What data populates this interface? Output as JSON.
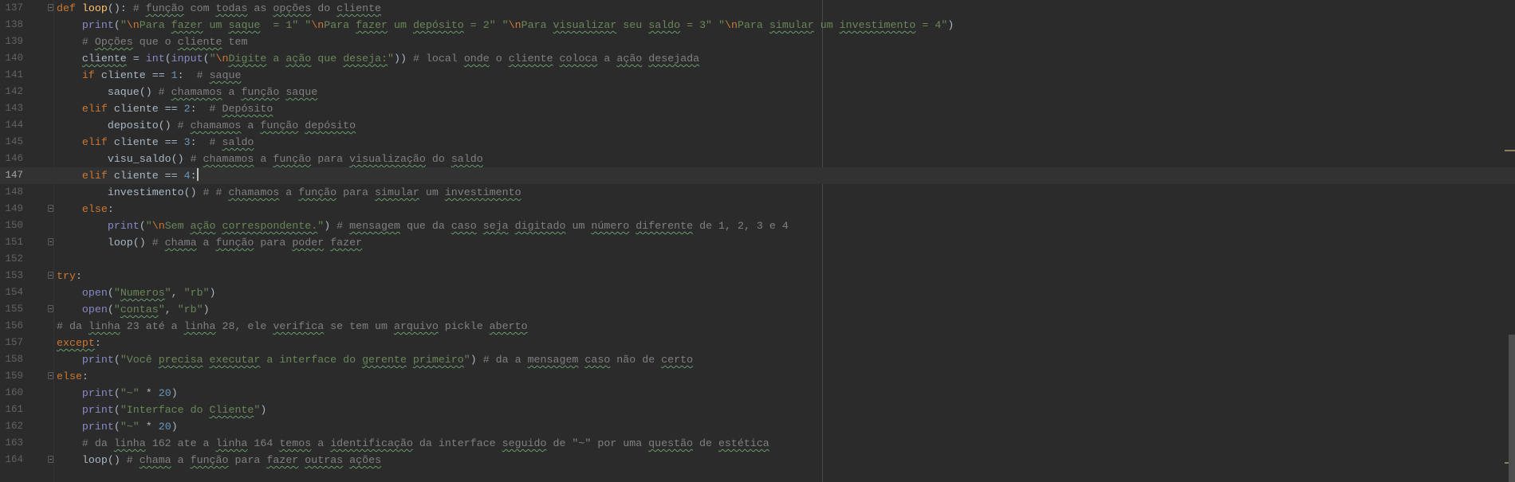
{
  "editor": {
    "current_line": 147,
    "markers": [
      "warning-marker",
      "warning-marker"
    ],
    "colors": {
      "background": "#2b2b2b",
      "keyword": "#cc7832",
      "string": "#6a8759",
      "comment": "#808080",
      "number": "#6897bb",
      "builtin": "#8888c6",
      "function_name": "#ffc66d",
      "text": "#a9b7c6"
    },
    "lines": [
      {
        "n": "137",
        "fold": true,
        "t": [
          [
            "k",
            "def "
          ],
          [
            "f",
            "loop"
          ],
          [
            "t",
            "(): "
          ],
          [
            "c",
            "# "
          ],
          [
            "cu",
            "função"
          ],
          [
            "c",
            " com "
          ],
          [
            "cu",
            "todas"
          ],
          [
            "c",
            " as "
          ],
          [
            "cu",
            "opções"
          ],
          [
            "c",
            " do "
          ],
          [
            "cu",
            "cliente"
          ]
        ]
      },
      {
        "n": "138",
        "t": [
          [
            "t",
            "    "
          ],
          [
            "b",
            "print"
          ],
          [
            "t",
            "("
          ],
          [
            "s",
            "\""
          ],
          [
            "e",
            "\\n"
          ],
          [
            "s",
            "Para "
          ],
          [
            "su",
            "fazer"
          ],
          [
            "s",
            " um "
          ],
          [
            "su",
            "saque"
          ],
          [
            "s",
            "  = 1\" \""
          ],
          [
            "e",
            "\\n"
          ],
          [
            "s",
            "Para "
          ],
          [
            "su",
            "fazer"
          ],
          [
            "s",
            " um "
          ],
          [
            "su",
            "depósito"
          ],
          [
            "s",
            " = 2\" \""
          ],
          [
            "e",
            "\\n"
          ],
          [
            "s",
            "Para "
          ],
          [
            "su",
            "visualizar"
          ],
          [
            "s",
            " seu "
          ],
          [
            "su",
            "saldo"
          ],
          [
            "s",
            " = 3\" \""
          ],
          [
            "e",
            "\\n"
          ],
          [
            "s",
            "Para "
          ],
          [
            "su",
            "simular"
          ],
          [
            "s",
            " um "
          ],
          [
            "su",
            "investimento"
          ],
          [
            "s",
            " = 4\""
          ],
          [
            "t",
            ")"
          ]
        ]
      },
      {
        "n": "139",
        "t": [
          [
            "t",
            "    "
          ],
          [
            "c",
            "# "
          ],
          [
            "cu",
            "Opções"
          ],
          [
            "c",
            " que o "
          ],
          [
            "cu",
            "cliente"
          ],
          [
            "c",
            " tem"
          ]
        ]
      },
      {
        "n": "140",
        "t": [
          [
            "t",
            "    "
          ],
          [
            "tu",
            "cliente"
          ],
          [
            "t",
            " = "
          ],
          [
            "b",
            "int"
          ],
          [
            "t",
            "("
          ],
          [
            "b",
            "input"
          ],
          [
            "t",
            "("
          ],
          [
            "s",
            "\""
          ],
          [
            "e",
            "\\n"
          ],
          [
            "su",
            "Digite"
          ],
          [
            "s",
            " a "
          ],
          [
            "su",
            "ação"
          ],
          [
            "s",
            " que "
          ],
          [
            "su",
            "deseja:"
          ],
          [
            "s",
            "\""
          ],
          [
            "t",
            ")) "
          ],
          [
            "c",
            "# local "
          ],
          [
            "cu",
            "onde"
          ],
          [
            "c",
            " o "
          ],
          [
            "cu",
            "cliente"
          ],
          [
            "c",
            " "
          ],
          [
            "cu",
            "coloca"
          ],
          [
            "c",
            " a "
          ],
          [
            "cu",
            "ação"
          ],
          [
            "c",
            " "
          ],
          [
            "cu",
            "desejada"
          ]
        ]
      },
      {
        "n": "141",
        "t": [
          [
            "t",
            "    "
          ],
          [
            "k",
            "if "
          ],
          [
            "t",
            "cliente == "
          ],
          [
            "n",
            "1"
          ],
          [
            "t",
            ":  "
          ],
          [
            "c",
            "# "
          ],
          [
            "cu",
            "saque"
          ]
        ]
      },
      {
        "n": "142",
        "t": [
          [
            "t",
            "        saque() "
          ],
          [
            "c",
            "# "
          ],
          [
            "cu",
            "chamamos"
          ],
          [
            "c",
            " a "
          ],
          [
            "cu",
            "função"
          ],
          [
            "c",
            " "
          ],
          [
            "cu",
            "saque"
          ]
        ]
      },
      {
        "n": "143",
        "t": [
          [
            "t",
            "    "
          ],
          [
            "k",
            "elif "
          ],
          [
            "t",
            "cliente == "
          ],
          [
            "n",
            "2"
          ],
          [
            "t",
            ":  "
          ],
          [
            "c",
            "# "
          ],
          [
            "cu",
            "Depósito"
          ]
        ]
      },
      {
        "n": "144",
        "t": [
          [
            "t",
            "        deposito() "
          ],
          [
            "c",
            "# "
          ],
          [
            "cu",
            "chamamos"
          ],
          [
            "c",
            " a "
          ],
          [
            "cu",
            "função"
          ],
          [
            "c",
            " "
          ],
          [
            "cu",
            "depósito"
          ]
        ]
      },
      {
        "n": "145",
        "t": [
          [
            "t",
            "    "
          ],
          [
            "k",
            "elif "
          ],
          [
            "t",
            "cliente == "
          ],
          [
            "n",
            "3"
          ],
          [
            "t",
            ":  "
          ],
          [
            "c",
            "# "
          ],
          [
            "cu",
            "saldo"
          ]
        ]
      },
      {
        "n": "146",
        "t": [
          [
            "t",
            "        visu_saldo() "
          ],
          [
            "c",
            "# "
          ],
          [
            "cu",
            "chamamos"
          ],
          [
            "c",
            " a "
          ],
          [
            "cu",
            "função"
          ],
          [
            "c",
            " para "
          ],
          [
            "cu",
            "visualização"
          ],
          [
            "c",
            " do "
          ],
          [
            "cu",
            "saldo"
          ]
        ]
      },
      {
        "n": "147",
        "caret": true,
        "t": [
          [
            "t",
            "    "
          ],
          [
            "k",
            "elif "
          ],
          [
            "t",
            "cliente == "
          ],
          [
            "n",
            "4"
          ],
          [
            "t",
            ":"
          ]
        ]
      },
      {
        "n": "148",
        "t": [
          [
            "t",
            "        investimento() "
          ],
          [
            "c",
            "# # "
          ],
          [
            "cu",
            "chamamos"
          ],
          [
            "c",
            " a "
          ],
          [
            "cu",
            "função"
          ],
          [
            "c",
            " para "
          ],
          [
            "cu",
            "simular"
          ],
          [
            "c",
            " um "
          ],
          [
            "cu",
            "investimento"
          ]
        ]
      },
      {
        "n": "149",
        "fold": true,
        "t": [
          [
            "t",
            "    "
          ],
          [
            "k",
            "else"
          ],
          [
            "t",
            ":"
          ]
        ]
      },
      {
        "n": "150",
        "t": [
          [
            "t",
            "        "
          ],
          [
            "b",
            "print"
          ],
          [
            "t",
            "("
          ],
          [
            "s",
            "\""
          ],
          [
            "e",
            "\\n"
          ],
          [
            "s",
            "Sem "
          ],
          [
            "su",
            "ação"
          ],
          [
            "s",
            " "
          ],
          [
            "su",
            "correspondente."
          ],
          [
            "s",
            "\""
          ],
          [
            "t",
            ") "
          ],
          [
            "c",
            "# "
          ],
          [
            "cu",
            "mensagem"
          ],
          [
            "c",
            " que da "
          ],
          [
            "cu",
            "caso"
          ],
          [
            "c",
            " "
          ],
          [
            "cu",
            "seja"
          ],
          [
            "c",
            " "
          ],
          [
            "cu",
            "digitado"
          ],
          [
            "c",
            " um "
          ],
          [
            "cu",
            "número"
          ],
          [
            "c",
            " "
          ],
          [
            "cu",
            "diferente"
          ],
          [
            "c",
            " de 1, 2, 3 e 4"
          ]
        ]
      },
      {
        "n": "151",
        "fold": true,
        "t": [
          [
            "t",
            "        loop() "
          ],
          [
            "c",
            "# "
          ],
          [
            "cu",
            "chama"
          ],
          [
            "c",
            " a "
          ],
          [
            "cu",
            "função"
          ],
          [
            "c",
            " para "
          ],
          [
            "cu",
            "poder"
          ],
          [
            "c",
            " "
          ],
          [
            "cu",
            "fazer"
          ]
        ]
      },
      {
        "n": "152",
        "t": []
      },
      {
        "n": "153",
        "fold": true,
        "t": [
          [
            "k",
            "try"
          ],
          [
            "t",
            ":"
          ]
        ]
      },
      {
        "n": "154",
        "t": [
          [
            "t",
            "    "
          ],
          [
            "b",
            "open"
          ],
          [
            "t",
            "("
          ],
          [
            "s",
            "\""
          ],
          [
            "su",
            "Numeros"
          ],
          [
            "s",
            "\""
          ],
          [
            "t",
            ", "
          ],
          [
            "s",
            "\"rb\""
          ],
          [
            "t",
            ")"
          ]
        ]
      },
      {
        "n": "155",
        "fold": true,
        "t": [
          [
            "t",
            "    "
          ],
          [
            "b",
            "open"
          ],
          [
            "t",
            "("
          ],
          [
            "s",
            "\""
          ],
          [
            "su",
            "contas"
          ],
          [
            "s",
            "\""
          ],
          [
            "t",
            ", "
          ],
          [
            "s",
            "\"rb\""
          ],
          [
            "t",
            ")"
          ]
        ]
      },
      {
        "n": "156",
        "t": [
          [
            "c",
            "# da "
          ],
          [
            "cu",
            "linha"
          ],
          [
            "c",
            " 23 até a "
          ],
          [
            "cu",
            "linha"
          ],
          [
            "c",
            " 28, ele "
          ],
          [
            "cu",
            "verifica"
          ],
          [
            "c",
            " se tem um "
          ],
          [
            "cu",
            "arquivo"
          ],
          [
            "c",
            " pickle "
          ],
          [
            "cu",
            "aberto"
          ]
        ]
      },
      {
        "n": "157",
        "t": [
          [
            "ku",
            "except"
          ],
          [
            "t",
            ":"
          ]
        ]
      },
      {
        "n": "158",
        "t": [
          [
            "t",
            "    "
          ],
          [
            "b",
            "print"
          ],
          [
            "t",
            "("
          ],
          [
            "s",
            "\"Você "
          ],
          [
            "su",
            "precisa"
          ],
          [
            "s",
            " "
          ],
          [
            "su",
            "executar"
          ],
          [
            "s",
            " a interface do "
          ],
          [
            "su",
            "gerente"
          ],
          [
            "s",
            " "
          ],
          [
            "su",
            "primeiro"
          ],
          [
            "s",
            "\""
          ],
          [
            "t",
            ") "
          ],
          [
            "c",
            "# da a "
          ],
          [
            "cu",
            "mensagem"
          ],
          [
            "c",
            " "
          ],
          [
            "cu",
            "caso"
          ],
          [
            "c",
            " não de "
          ],
          [
            "cu",
            "certo"
          ]
        ]
      },
      {
        "n": "159",
        "fold": true,
        "t": [
          [
            "k",
            "else"
          ],
          [
            "t",
            ":"
          ]
        ]
      },
      {
        "n": "160",
        "t": [
          [
            "t",
            "    "
          ],
          [
            "b",
            "print"
          ],
          [
            "t",
            "("
          ],
          [
            "s",
            "\"~\""
          ],
          [
            "t",
            " * "
          ],
          [
            "n",
            "20"
          ],
          [
            "t",
            ")"
          ]
        ]
      },
      {
        "n": "161",
        "t": [
          [
            "t",
            "    "
          ],
          [
            "b",
            "print"
          ],
          [
            "t",
            "("
          ],
          [
            "s",
            "\"Interface do "
          ],
          [
            "su",
            "Cliente"
          ],
          [
            "s",
            "\""
          ],
          [
            "t",
            ")"
          ]
        ]
      },
      {
        "n": "162",
        "t": [
          [
            "t",
            "    "
          ],
          [
            "b",
            "print"
          ],
          [
            "t",
            "("
          ],
          [
            "s",
            "\"~\""
          ],
          [
            "t",
            " * "
          ],
          [
            "n",
            "20"
          ],
          [
            "t",
            ")"
          ]
        ]
      },
      {
        "n": "163",
        "t": [
          [
            "t",
            "    "
          ],
          [
            "c",
            "# da "
          ],
          [
            "cu",
            "linha"
          ],
          [
            "c",
            " 162 ate a "
          ],
          [
            "cu",
            "linha"
          ],
          [
            "c",
            " 164 "
          ],
          [
            "cu",
            "temos"
          ],
          [
            "c",
            " a "
          ],
          [
            "cu",
            "identificação"
          ],
          [
            "c",
            " da interface "
          ],
          [
            "cu",
            "seguido"
          ],
          [
            "c",
            " de \"~\" por uma "
          ],
          [
            "cu",
            "questão"
          ],
          [
            "c",
            " de "
          ],
          [
            "cu",
            "estética"
          ]
        ]
      },
      {
        "n": "164",
        "fold": true,
        "t": [
          [
            "t",
            "    loop() "
          ],
          [
            "c",
            "# "
          ],
          [
            "cu",
            "chama"
          ],
          [
            "c",
            " a "
          ],
          [
            "cu",
            "função"
          ],
          [
            "c",
            " para "
          ],
          [
            "cu",
            "fazer"
          ],
          [
            "c",
            " "
          ],
          [
            "cu",
            "outras"
          ],
          [
            "c",
            " "
          ],
          [
            "cu",
            "ações"
          ]
        ]
      }
    ]
  }
}
